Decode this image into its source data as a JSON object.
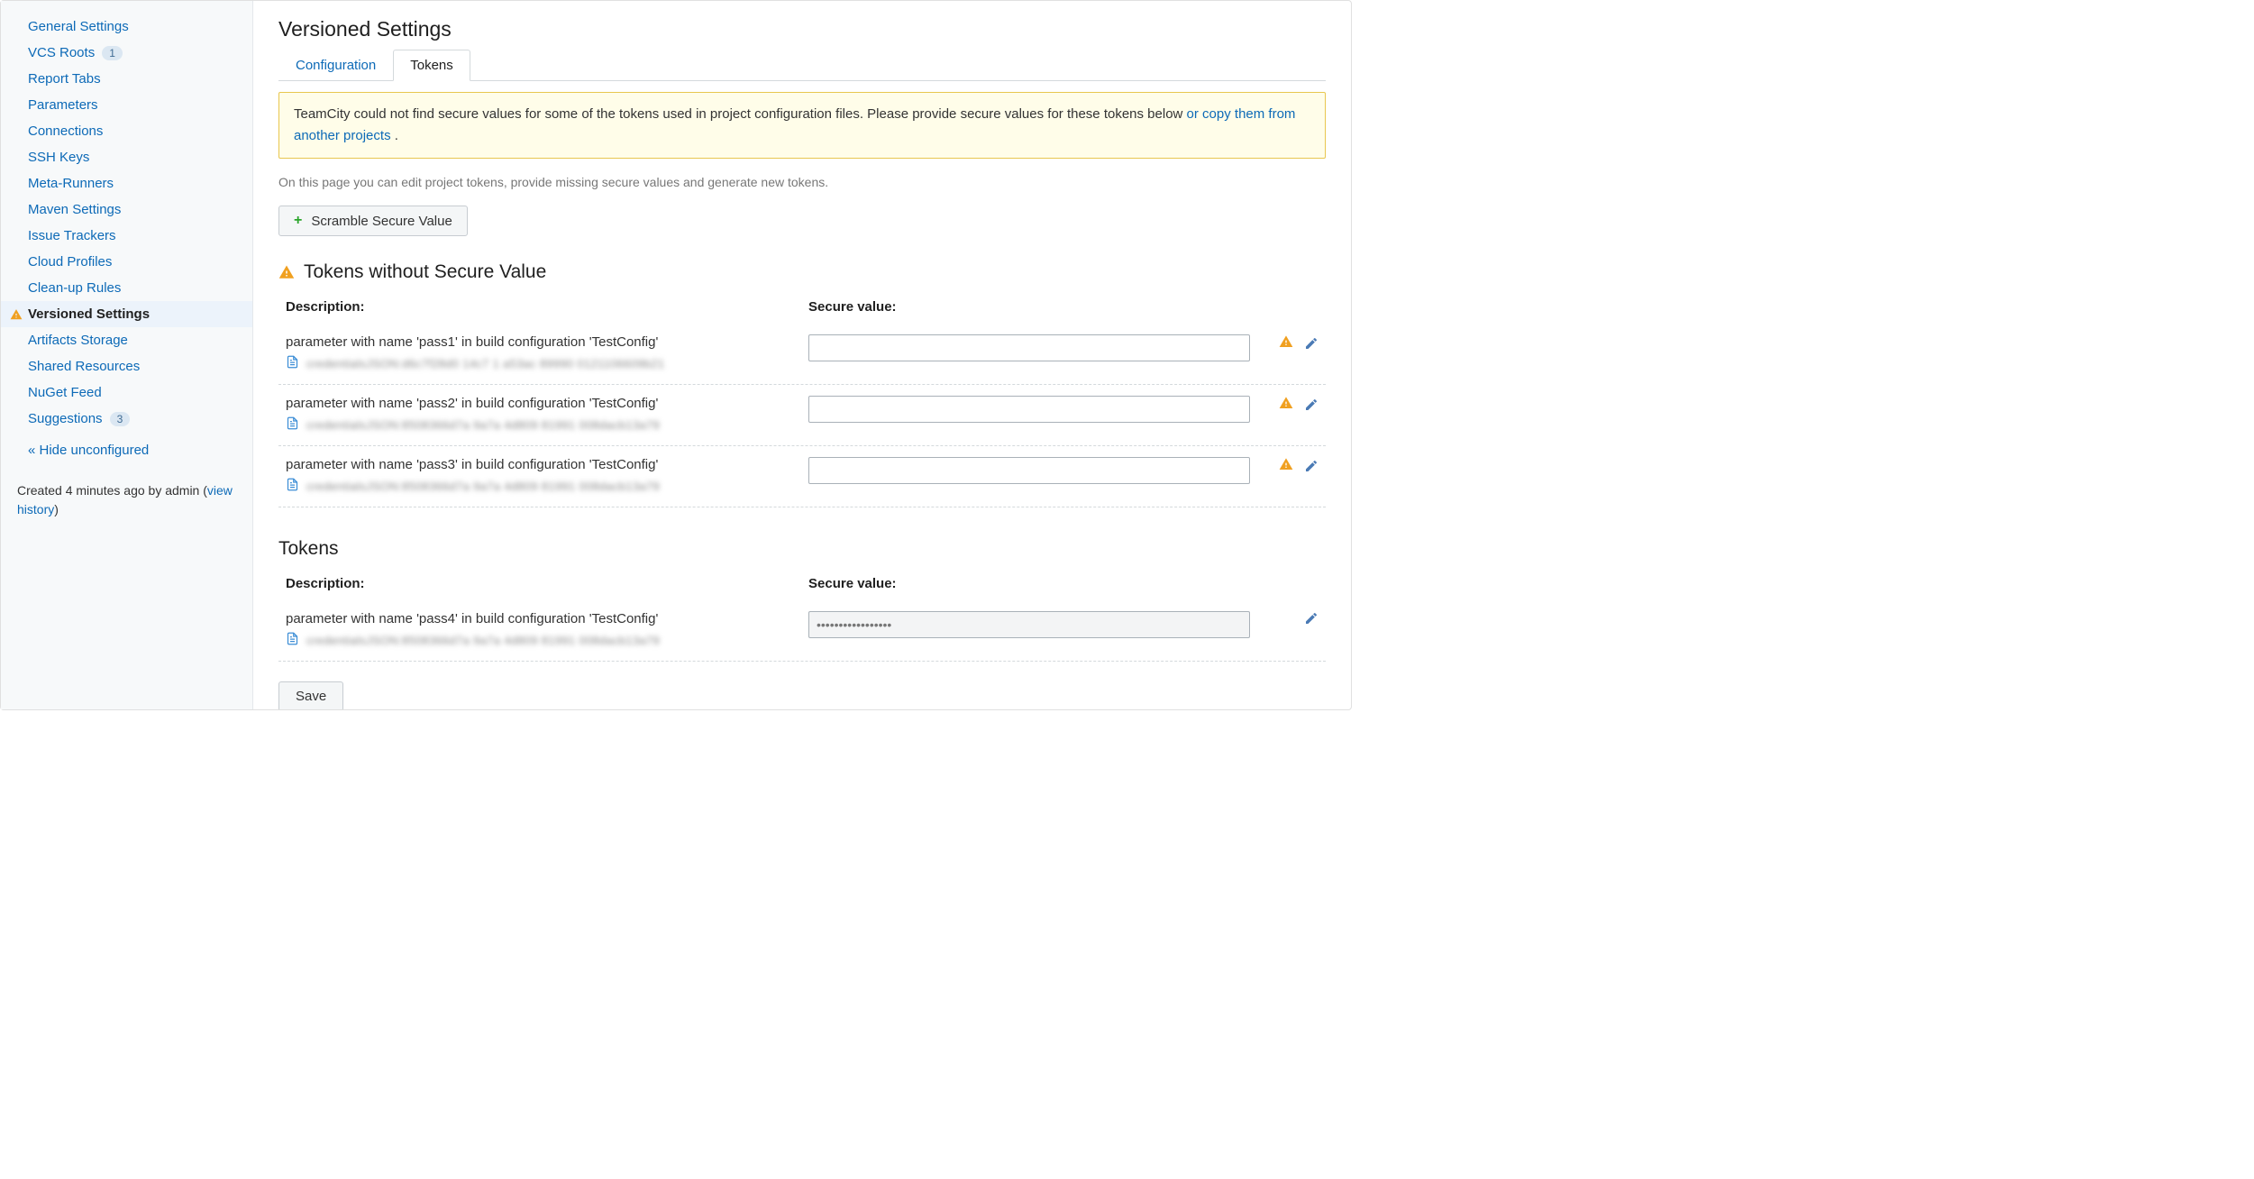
{
  "sidebar": {
    "items": [
      {
        "label": "General Settings",
        "active": false,
        "warn": false,
        "badge": null
      },
      {
        "label": "VCS Roots",
        "active": false,
        "warn": false,
        "badge": "1"
      },
      {
        "label": "Report Tabs",
        "active": false,
        "warn": false,
        "badge": null
      },
      {
        "label": "Parameters",
        "active": false,
        "warn": false,
        "badge": null
      },
      {
        "label": "Connections",
        "active": false,
        "warn": false,
        "badge": null
      },
      {
        "label": "SSH Keys",
        "active": false,
        "warn": false,
        "badge": null
      },
      {
        "label": "Meta-Runners",
        "active": false,
        "warn": false,
        "badge": null
      },
      {
        "label": "Maven Settings",
        "active": false,
        "warn": false,
        "badge": null
      },
      {
        "label": "Issue Trackers",
        "active": false,
        "warn": false,
        "badge": null
      },
      {
        "label": "Cloud Profiles",
        "active": false,
        "warn": false,
        "badge": null
      },
      {
        "label": "Clean-up Rules",
        "active": false,
        "warn": false,
        "badge": null
      },
      {
        "label": "Versioned Settings",
        "active": true,
        "warn": true,
        "badge": null
      },
      {
        "label": "Artifacts Storage",
        "active": false,
        "warn": false,
        "badge": null
      },
      {
        "label": "Shared Resources",
        "active": false,
        "warn": false,
        "badge": null
      },
      {
        "label": "NuGet Feed",
        "active": false,
        "warn": false,
        "badge": null
      },
      {
        "label": "Suggestions",
        "active": false,
        "warn": false,
        "badge": "3"
      }
    ],
    "hide_unconfigured": "« Hide unconfigured",
    "meta_text_pre": "Created 4 minutes ago by admin (",
    "meta_link": "view history",
    "meta_text_post": ")"
  },
  "page": {
    "title": "Versioned Settings",
    "tabs": [
      {
        "label": "Configuration",
        "active": false
      },
      {
        "label": "Tokens",
        "active": true
      }
    ],
    "alert_text": "TeamCity could not find secure values for some of the tokens used in project configuration files. Please provide secure values for these tokens below ",
    "alert_link": "or copy them from another projects",
    "alert_period": " .",
    "help_text": "On this page you can edit project tokens, provide missing secure values and generate new tokens.",
    "scramble_button": "Scramble Secure Value",
    "section1_title": "Tokens without Secure Value",
    "section2_title": "Tokens",
    "col_description": "Description:",
    "col_secure": "Secure value:",
    "save_button": "Save",
    "tokens_missing": [
      {
        "desc": "parameter with name 'pass1' in build configuration 'TestConfig'",
        "cred": "credentialsJSON:d6c7f28d0 14c7 1 a53ac 89990 0121106609b21",
        "value": ""
      },
      {
        "desc": "parameter with name 'pass2' in build configuration 'TestConfig'",
        "cred": "credentialsJSON:8508366d7a 9a7a 4d809 81991 008dacb13a79",
        "value": ""
      },
      {
        "desc": "parameter with name 'pass3' in build configuration 'TestConfig'",
        "cred": "credentialsJSON:8508366d7a 9a7a 4d809 81991 008dacb13a79",
        "value": ""
      }
    ],
    "tokens_present": [
      {
        "desc": "parameter with name 'pass4' in build configuration 'TestConfig'",
        "cred": "credentialsJSON:8508366d7a 9a7a 4d809 81991 008dacb13a79",
        "value": "•••••••••••••••••"
      }
    ]
  }
}
